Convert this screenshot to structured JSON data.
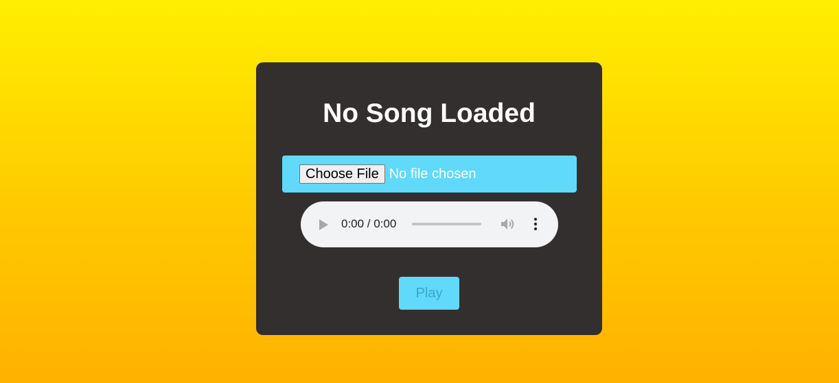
{
  "player": {
    "title": "No Song Loaded",
    "file_input": {
      "button_label": "Choose File",
      "status": "No file chosen"
    },
    "audio": {
      "time": "0:00 / 0:00",
      "progress": 0,
      "icons": [
        "play-icon",
        "volume-icon",
        "more-options-icon"
      ]
    },
    "play_button_label": "Play"
  },
  "colors": {
    "background_top": "#ffef00",
    "background_bottom": "#ffb200",
    "card": "#332f2e",
    "accent": "#61d9fa",
    "play_text": "#3aa7c6",
    "audio_bg": "#f1f3f4"
  }
}
